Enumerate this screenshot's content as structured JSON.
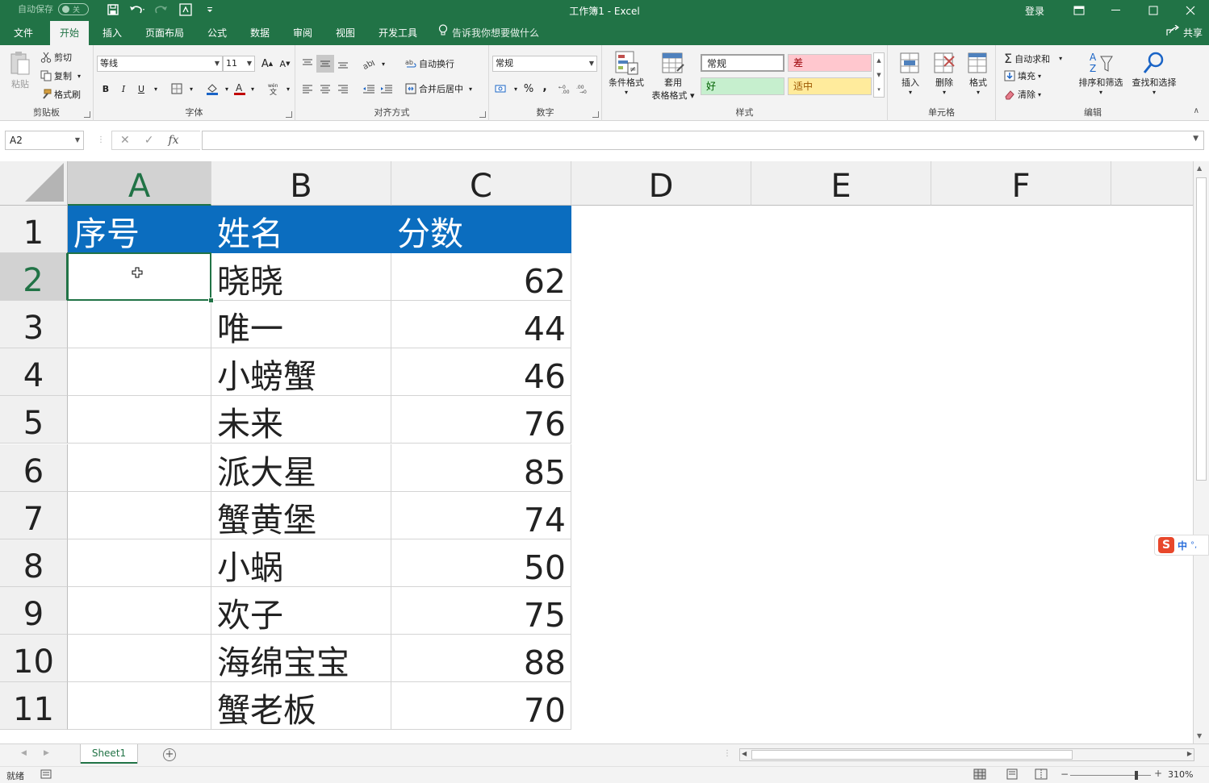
{
  "titlebar": {
    "autosave_label": "自动保存",
    "autosave_state": "关",
    "title": "工作簿1  -  Excel",
    "login": "登录"
  },
  "tabs": [
    "文件",
    "开始",
    "插入",
    "页面布局",
    "公式",
    "数据",
    "审阅",
    "视图",
    "开发工具"
  ],
  "active_tab": "开始",
  "tell_me": "告诉我你想要做什么",
  "share": "共享",
  "ribbon": {
    "clipboard": {
      "label": "剪贴板",
      "paste": "粘贴",
      "cut": "剪切",
      "copy": "复制",
      "format_painter": "格式刷"
    },
    "font": {
      "label": "字体",
      "name": "等线",
      "size": "11"
    },
    "alignment": {
      "label": "对齐方式",
      "wrap": "自动换行",
      "merge": "合并后居中"
    },
    "number": {
      "label": "数字",
      "format": "常规",
      "percent": "%",
      "comma": ","
    },
    "styles": {
      "label": "样式",
      "conditional": "条件格式",
      "table_a": "套用",
      "table_b": "表格格式",
      "normal": "常规",
      "bad": "差",
      "good": "好",
      "neutral": "适中"
    },
    "cells": {
      "label": "单元格",
      "insert": "插入",
      "delete": "删除",
      "format": "格式"
    },
    "editing": {
      "label": "编辑",
      "autosum": "自动求和",
      "fill": "填充",
      "clear": "清除",
      "sort": "排序和筛选",
      "find": "查找和选择"
    }
  },
  "formula_bar": {
    "name_box": "A2",
    "formula": ""
  },
  "columns": [
    "A",
    "B",
    "C",
    "D",
    "E",
    "F"
  ],
  "rows": [
    "1",
    "2",
    "3",
    "4",
    "5",
    "6",
    "7",
    "8",
    "9",
    "10",
    "11"
  ],
  "table": {
    "header": [
      "序号",
      "姓名",
      "分数"
    ],
    "body": [
      {
        "seq": "",
        "name": "晓晓",
        "score": "62"
      },
      {
        "seq": "",
        "name": "唯一",
        "score": "44"
      },
      {
        "seq": "",
        "name": "小螃蟹",
        "score": "46"
      },
      {
        "seq": "",
        "name": "未来",
        "score": "76"
      },
      {
        "seq": "",
        "name": "派大星",
        "score": "85"
      },
      {
        "seq": "",
        "name": "蟹黄堡",
        "score": "74"
      },
      {
        "seq": "",
        "name": "小蜗",
        "score": "50"
      },
      {
        "seq": "",
        "name": "欢子",
        "score": "75"
      },
      {
        "seq": "",
        "name": "海绵宝宝",
        "score": "88"
      },
      {
        "seq": "",
        "name": "蟹老板",
        "score": "70"
      }
    ]
  },
  "sheet_tab": "Sheet1",
  "status": {
    "ready": "就绪",
    "zoom": "310%"
  },
  "ime": {
    "mode": "中"
  },
  "colors": {
    "excel_green": "#217346",
    "header_fill": "#0b6dbf",
    "bad_fill": "#ffc7ce",
    "good_fill": "#c6efce",
    "neutral_fill": "#ffeb9c"
  }
}
